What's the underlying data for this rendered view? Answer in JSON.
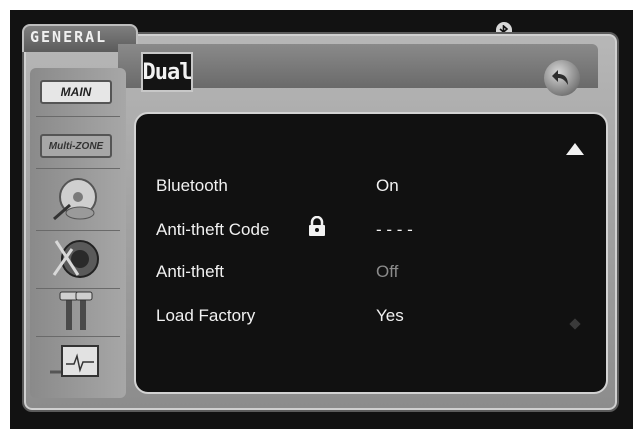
{
  "status": {
    "bluetooth_icon": "bluetooth-icon"
  },
  "header": {
    "tab_label": "GENERAL",
    "brand_logo_text": "Dual",
    "back_button_icon": "back-arrow-icon"
  },
  "sidebar": {
    "items": [
      {
        "label": "MAIN",
        "type": "text-button"
      },
      {
        "label": "Multi-ZONE",
        "type": "text-button"
      },
      {
        "icon": "disc-icon"
      },
      {
        "icon": "speaker-icon"
      },
      {
        "icon": "tools-icon"
      },
      {
        "icon": "monitor-icon"
      }
    ]
  },
  "settings": {
    "rows": [
      {
        "label": "Bluetooth",
        "value": "On"
      },
      {
        "label": "Anti-theft Code",
        "value": "- - - -",
        "icon": "lock-icon"
      },
      {
        "label": "Anti-theft",
        "value": "Off",
        "value_state": "disabled"
      },
      {
        "label": "Load Factory",
        "value": "Yes"
      }
    ],
    "scroll_up_icon": "scroll-up-icon",
    "scroll_down_icon": "scroll-down-icon"
  },
  "colors": {
    "background": "#121212",
    "frame": "#a0a0a0",
    "text": "#f1f1f1",
    "dim_text": "#8b8b8b"
  }
}
